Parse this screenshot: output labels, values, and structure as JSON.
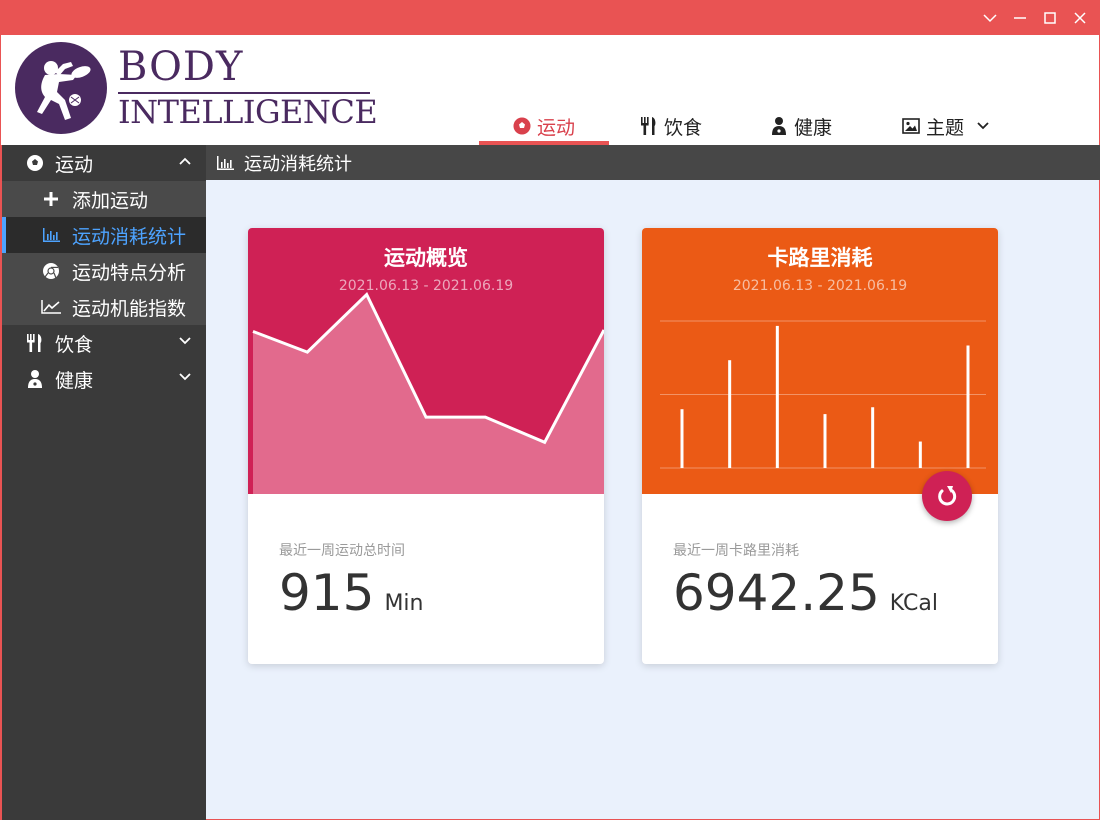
{
  "window": {
    "controls": [
      "chevron-down",
      "minimize",
      "maximize",
      "close"
    ]
  },
  "logo": {
    "line1": "BODY",
    "line2": "INTELLIGENCE"
  },
  "nav": {
    "tabs": [
      {
        "label": "运动",
        "icon": "soccer-ball-icon",
        "active": true
      },
      {
        "label": "饮食",
        "icon": "utensils-icon",
        "active": false
      },
      {
        "label": "健康",
        "icon": "doctor-icon",
        "active": false
      },
      {
        "label": "主题",
        "icon": "image-icon",
        "active": false
      }
    ]
  },
  "sidebar": {
    "groups": [
      {
        "label": "运动",
        "expanded": true,
        "items": [
          {
            "label": "添加运动"
          },
          {
            "label": "运动消耗统计",
            "selected": true
          },
          {
            "label": "运动特点分析"
          },
          {
            "label": "运动机能指数"
          }
        ]
      },
      {
        "label": "饮食",
        "expanded": false
      },
      {
        "label": "健康",
        "expanded": false
      }
    ]
  },
  "page": {
    "title": "运动消耗统计"
  },
  "cards": {
    "exercise": {
      "title": "运动概览",
      "date_range": "2021.06.13 - 2021.06.19",
      "label": "最近一周运动总时间",
      "value": "915",
      "unit": "Min",
      "color": "#cf2155"
    },
    "calories": {
      "title": "卡路里消耗",
      "date_range": "2021.06.13 - 2021.06.19",
      "label": "最近一周卡路里消耗",
      "value": "6942.25",
      "unit": "KCal",
      "color": "#eb5a15"
    }
  },
  "chart_data": [
    {
      "type": "area",
      "values": [
        110,
        96,
        135,
        52,
        52,
        35,
        111
      ],
      "ylim": [
        0,
        180
      ],
      "grid": false
    },
    {
      "type": "bar",
      "values": [
        60,
        110,
        145,
        55,
        62,
        27,
        125
      ],
      "ylim": [
        0,
        150
      ],
      "grid": true
    }
  ]
}
